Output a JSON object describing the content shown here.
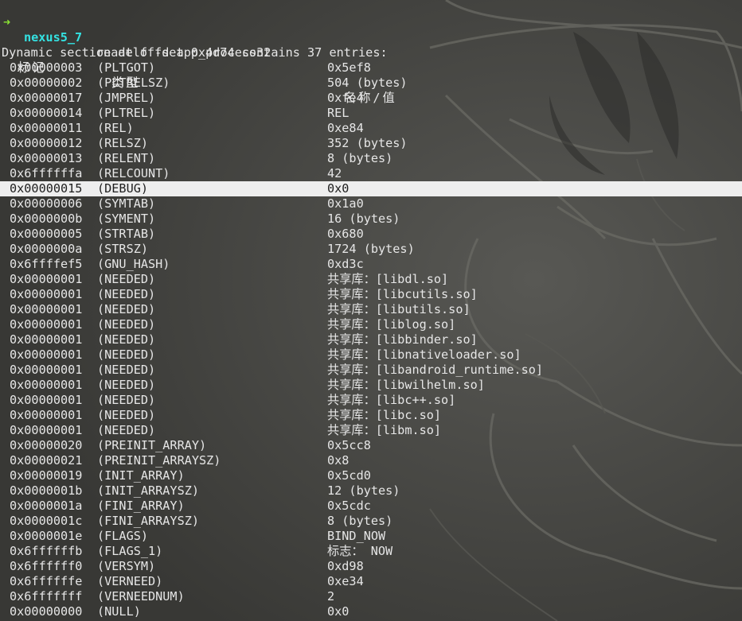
{
  "terminal": {
    "prompt_arrow": "➜",
    "host": "nexus5_7",
    "command": "readelf -d app_process32",
    "header": "Dynamic section at offset 0x4d74 contains 37 entries:",
    "columns": {
      "tag": "标记",
      "type": "类型",
      "value": "名称/值"
    },
    "selected_row": 8,
    "rows": [
      {
        "tag": "0x00000003",
        "type": "(PLTGOT)",
        "value": "0x5ef8"
      },
      {
        "tag": "0x00000002",
        "type": "(PLTRELSZ)",
        "value": "504 (bytes)"
      },
      {
        "tag": "0x00000017",
        "type": "(JMPREL)",
        "value": "0xfe4"
      },
      {
        "tag": "0x00000014",
        "type": "(PLTREL)",
        "value": "REL"
      },
      {
        "tag": "0x00000011",
        "type": "(REL)",
        "value": "0xe84"
      },
      {
        "tag": "0x00000012",
        "type": "(RELSZ)",
        "value": "352 (bytes)"
      },
      {
        "tag": "0x00000013",
        "type": "(RELENT)",
        "value": "8 (bytes)"
      },
      {
        "tag": "0x6ffffffa",
        "type": "(RELCOUNT)",
        "value": "42"
      },
      {
        "tag": "0x00000015",
        "type": "(DEBUG)",
        "value": "0x0"
      },
      {
        "tag": "0x00000006",
        "type": "(SYMTAB)",
        "value": "0x1a0"
      },
      {
        "tag": "0x0000000b",
        "type": "(SYMENT)",
        "value": "16 (bytes)"
      },
      {
        "tag": "0x00000005",
        "type": "(STRTAB)",
        "value": "0x680"
      },
      {
        "tag": "0x0000000a",
        "type": "(STRSZ)",
        "value": "1724 (bytes)"
      },
      {
        "tag": "0x6ffffef5",
        "type": "(GNU_HASH)",
        "value": "0xd3c"
      },
      {
        "tag": "0x00000001",
        "type": "(NEEDED)",
        "value": "共享库：[libdl.so]"
      },
      {
        "tag": "0x00000001",
        "type": "(NEEDED)",
        "value": "共享库：[libcutils.so]"
      },
      {
        "tag": "0x00000001",
        "type": "(NEEDED)",
        "value": "共享库：[libutils.so]"
      },
      {
        "tag": "0x00000001",
        "type": "(NEEDED)",
        "value": "共享库：[liblog.so]"
      },
      {
        "tag": "0x00000001",
        "type": "(NEEDED)",
        "value": "共享库：[libbinder.so]"
      },
      {
        "tag": "0x00000001",
        "type": "(NEEDED)",
        "value": "共享库：[libnativeloader.so]"
      },
      {
        "tag": "0x00000001",
        "type": "(NEEDED)",
        "value": "共享库：[libandroid_runtime.so]"
      },
      {
        "tag": "0x00000001",
        "type": "(NEEDED)",
        "value": "共享库：[libwilhelm.so]"
      },
      {
        "tag": "0x00000001",
        "type": "(NEEDED)",
        "value": "共享库：[libc++.so]"
      },
      {
        "tag": "0x00000001",
        "type": "(NEEDED)",
        "value": "共享库：[libc.so]"
      },
      {
        "tag": "0x00000001",
        "type": "(NEEDED)",
        "value": "共享库：[libm.so]"
      },
      {
        "tag": "0x00000020",
        "type": "(PREINIT_ARRAY)",
        "value": "0x5cc8"
      },
      {
        "tag": "0x00000021",
        "type": "(PREINIT_ARRAYSZ)",
        "value": "0x8"
      },
      {
        "tag": "0x00000019",
        "type": "(INIT_ARRAY)",
        "value": "0x5cd0"
      },
      {
        "tag": "0x0000001b",
        "type": "(INIT_ARRAYSZ)",
        "value": "12 (bytes)"
      },
      {
        "tag": "0x0000001a",
        "type": "(FINI_ARRAY)",
        "value": "0x5cdc"
      },
      {
        "tag": "0x0000001c",
        "type": "(FINI_ARRAYSZ)",
        "value": "8 (bytes)"
      },
      {
        "tag": "0x0000001e",
        "type": "(FLAGS)",
        "value": "BIND_NOW"
      },
      {
        "tag": "0x6ffffffb",
        "type": "(FLAGS_1)",
        "value": "标志： NOW"
      },
      {
        "tag": "0x6ffffff0",
        "type": "(VERSYM)",
        "value": "0xd98"
      },
      {
        "tag": "0x6ffffffe",
        "type": "(VERNEED)",
        "value": "0xe34"
      },
      {
        "tag": "0x6fffffff",
        "type": "(VERNEEDNUM)",
        "value": "2"
      },
      {
        "tag": "0x00000000",
        "type": "(NULL)",
        "value": "0x0"
      }
    ]
  },
  "colors": {
    "background": "#3b3b38",
    "text": "#e6e6e6",
    "prompt_arrow": "#8ae234",
    "host": "#34e2e2",
    "selection_bg": "#eeeeee",
    "selection_fg": "#1e1e1e"
  }
}
